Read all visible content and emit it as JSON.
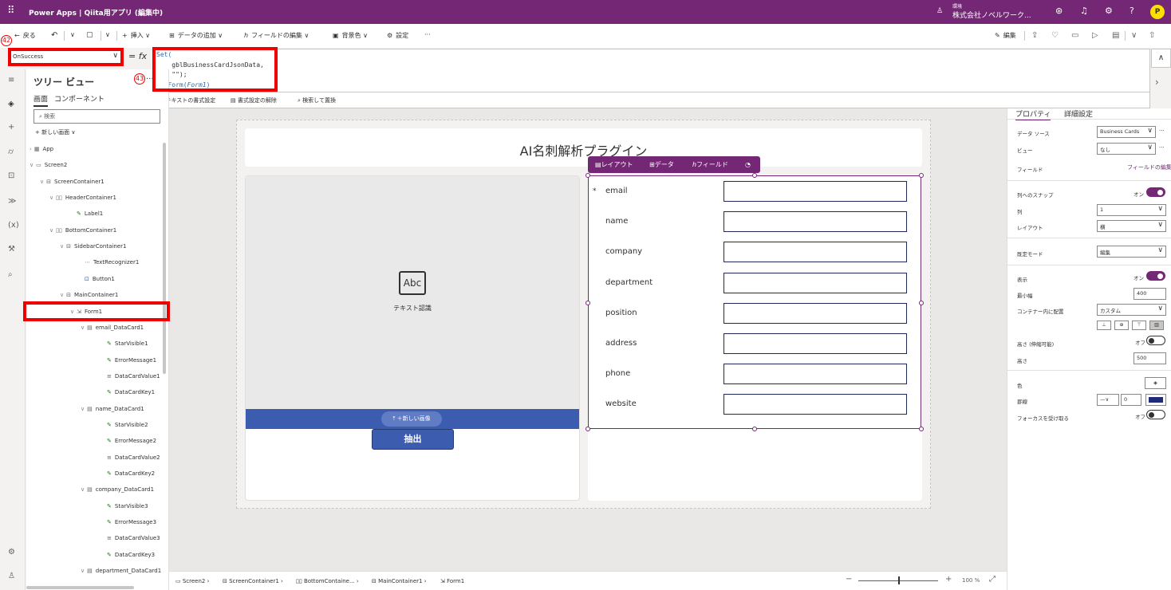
{
  "app": {
    "title": "Power Apps | Qiita用アプリ (編集中)",
    "env_label": "環境",
    "env_name": "株式会社ノベルワーク..."
  },
  "colors": {
    "brand": "#742774",
    "form_input_border": "#1f2a5a",
    "image_bar": "#3c5cb0",
    "annotation": "#e00000"
  },
  "commandbar": {
    "back": "戻る",
    "insert": "挿入",
    "add_data": "データの追加",
    "edit_fields": "フィールドの編集",
    "background": "背景色",
    "settings": "設定",
    "more": "···",
    "edit": "編集"
  },
  "formula": {
    "property": "OnSuccess",
    "line1": "Set(",
    "line2": "    gblBusinessCardJsonData,",
    "line3": "    \"\");",
    "line4_fn": "NewForm(",
    "line4_arg": "Form1",
    "line4_end": ")",
    "format_text": "テキストの書式設定",
    "remove_format": "書式設定の解除",
    "find_replace": "検索して置換"
  },
  "annotations": {
    "n42": "42",
    "n43": "43"
  },
  "tree": {
    "title": "ツリー ビュー",
    "tab_screens": "画面",
    "tab_components": "コンポーネント",
    "search_placeholder": "検索",
    "new_screen": "新しい画面",
    "nodes": [
      {
        "label": "App"
      },
      {
        "label": "Screen2"
      },
      {
        "label": "ScreenContainer1"
      },
      {
        "label": "HeaderContainer1"
      },
      {
        "label": "Label1"
      },
      {
        "label": "BottomContainer1"
      },
      {
        "label": "SidebarContainer1"
      },
      {
        "label": "TextRecognizer1"
      },
      {
        "label": "Button1"
      },
      {
        "label": "MainContainer1"
      },
      {
        "label": "Form1"
      },
      {
        "label": "email_DataCard1"
      },
      {
        "label": "StarVisible1"
      },
      {
        "label": "ErrorMessage1"
      },
      {
        "label": "DataCardValue1"
      },
      {
        "label": "DataCardKey1"
      },
      {
        "label": "name_DataCard1"
      },
      {
        "label": "StarVisible2"
      },
      {
        "label": "ErrorMessage2"
      },
      {
        "label": "DataCardValue2"
      },
      {
        "label": "DataCardKey2"
      },
      {
        "label": "company_DataCard1"
      },
      {
        "label": "StarVisible3"
      },
      {
        "label": "ErrorMessage3"
      },
      {
        "label": "DataCardValue3"
      },
      {
        "label": "DataCardKey3"
      },
      {
        "label": "department_DataCard1"
      }
    ]
  },
  "canvas": {
    "header_title": "AI名刺解析プラグイン",
    "abc": "Abc",
    "text_recognition": "テキスト認識",
    "new_image": "＋新しい画像",
    "extract": "抽出",
    "form_toolbar": {
      "layout": "レイアウト",
      "data": "データ",
      "fields": "フィールド"
    },
    "fields": [
      {
        "label": "email",
        "required": true
      },
      {
        "label": "name",
        "required": false
      },
      {
        "label": "company",
        "required": false
      },
      {
        "label": "department",
        "required": false
      },
      {
        "label": "position",
        "required": false
      },
      {
        "label": "address",
        "required": false
      },
      {
        "label": "phone",
        "required": false
      },
      {
        "label": "website",
        "required": false
      }
    ],
    "required_mark": "*"
  },
  "props": {
    "tab_properties": "プロパティ",
    "tab_advanced": "詳細設定",
    "data_source_label": "データ ソース",
    "data_source_value": "Business Cards",
    "view_label": "ビュー",
    "view_value": "なし",
    "fields_label": "フィールド",
    "fields_link": "フィールドの編集",
    "snap_label": "列へのスナップ",
    "snap_state": "オン",
    "columns_label": "列",
    "columns_value": "1",
    "layout_label": "レイアウト",
    "layout_value": "横",
    "default_mode_label": "既定モード",
    "default_mode_value": "編集",
    "visible_label": "表示",
    "visible_state": "オン",
    "min_width_label": "最小幅",
    "min_width_value": "400",
    "align_label": "コンテナー内に配置",
    "align_value": "カスタム",
    "height_flex_label": "高さ (伸縮可能)",
    "height_flex_state": "オフ",
    "height_label": "高さ",
    "height_value": "500",
    "color_label": "色",
    "border_label": "罫線",
    "border_value": "0",
    "focus_label": "フォーカスを受け取る",
    "focus_state": "オフ"
  },
  "statusbar": {
    "crumbs": [
      "Screen2",
      "ScreenContainer1",
      "BottomContaine...",
      "MainContainer1",
      "Form1"
    ],
    "zoom": "100 %"
  }
}
